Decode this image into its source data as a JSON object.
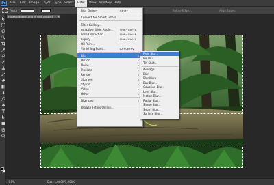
{
  "menubar": {
    "logo": "Ps",
    "items": [
      "File",
      "Edit",
      "Image",
      "Layer",
      "Type",
      "Select",
      "Filter",
      "View",
      "Window",
      "Help"
    ],
    "active_index": 6
  },
  "options_bar": {
    "feather_label": "Feath",
    "refine_edge_label": "Refine Edge...",
    "align_edges_label": "Align Edges"
  },
  "document": {
    "tab_title": "Hutan (sabang).png @ 50% (RGB/8)",
    "close_glyph": "×"
  },
  "filter_menu": {
    "items": [
      {
        "label": "Blur Gallery",
        "shortcut": "Ctrl+F"
      },
      {
        "label": "Convert for Smart Filters",
        "shortcut": ""
      },
      {
        "label": "Filter Gallery...",
        "shortcut": ""
      },
      {
        "label": "Adaptive Wide Angle...",
        "shortcut": "Shift+Ctrl+A"
      },
      {
        "label": "Lens Correction...",
        "shortcut": "Shift+Ctrl+R"
      },
      {
        "label": "Liquify...",
        "shortcut": "Shift+Ctrl+X"
      },
      {
        "label": "Oil Paint...",
        "shortcut": ""
      },
      {
        "label": "Vanishing Point...",
        "shortcut": "Alt+Ctrl+V"
      },
      {
        "label": "Blur",
        "shortcut": ""
      },
      {
        "label": "Distort",
        "shortcut": ""
      },
      {
        "label": "Noise",
        "shortcut": ""
      },
      {
        "label": "Pixelate",
        "shortcut": ""
      },
      {
        "label": "Render",
        "shortcut": ""
      },
      {
        "label": "Sharpen",
        "shortcut": ""
      },
      {
        "label": "Stylize",
        "shortcut": ""
      },
      {
        "label": "Video",
        "shortcut": ""
      },
      {
        "label": "Other",
        "shortcut": ""
      },
      {
        "label": "Digimarc",
        "shortcut": ""
      },
      {
        "label": "Browse Filters Online...",
        "shortcut": ""
      }
    ],
    "highlighted_index": 8,
    "submenu_arrow": "▸"
  },
  "blur_submenu": {
    "items": [
      "Field Blur...",
      "Iris Blur...",
      "Tilt-Shift...",
      "Average",
      "Blur",
      "Blur More",
      "Box Blur...",
      "Gaussian Blur...",
      "Lens Blur...",
      "Motion Blur...",
      "Radial Blur...",
      "Shape Blur...",
      "Smart Blur...",
      "Surface Blur..."
    ],
    "highlighted_index": 0
  },
  "status_bar": {
    "zoom": "50%",
    "doc_size": "Doc: 1,000K/1,000K"
  },
  "colors": {
    "menu_highlight": "#3e7ed6",
    "menu_background": "#efefef",
    "app_background": "#282828"
  }
}
